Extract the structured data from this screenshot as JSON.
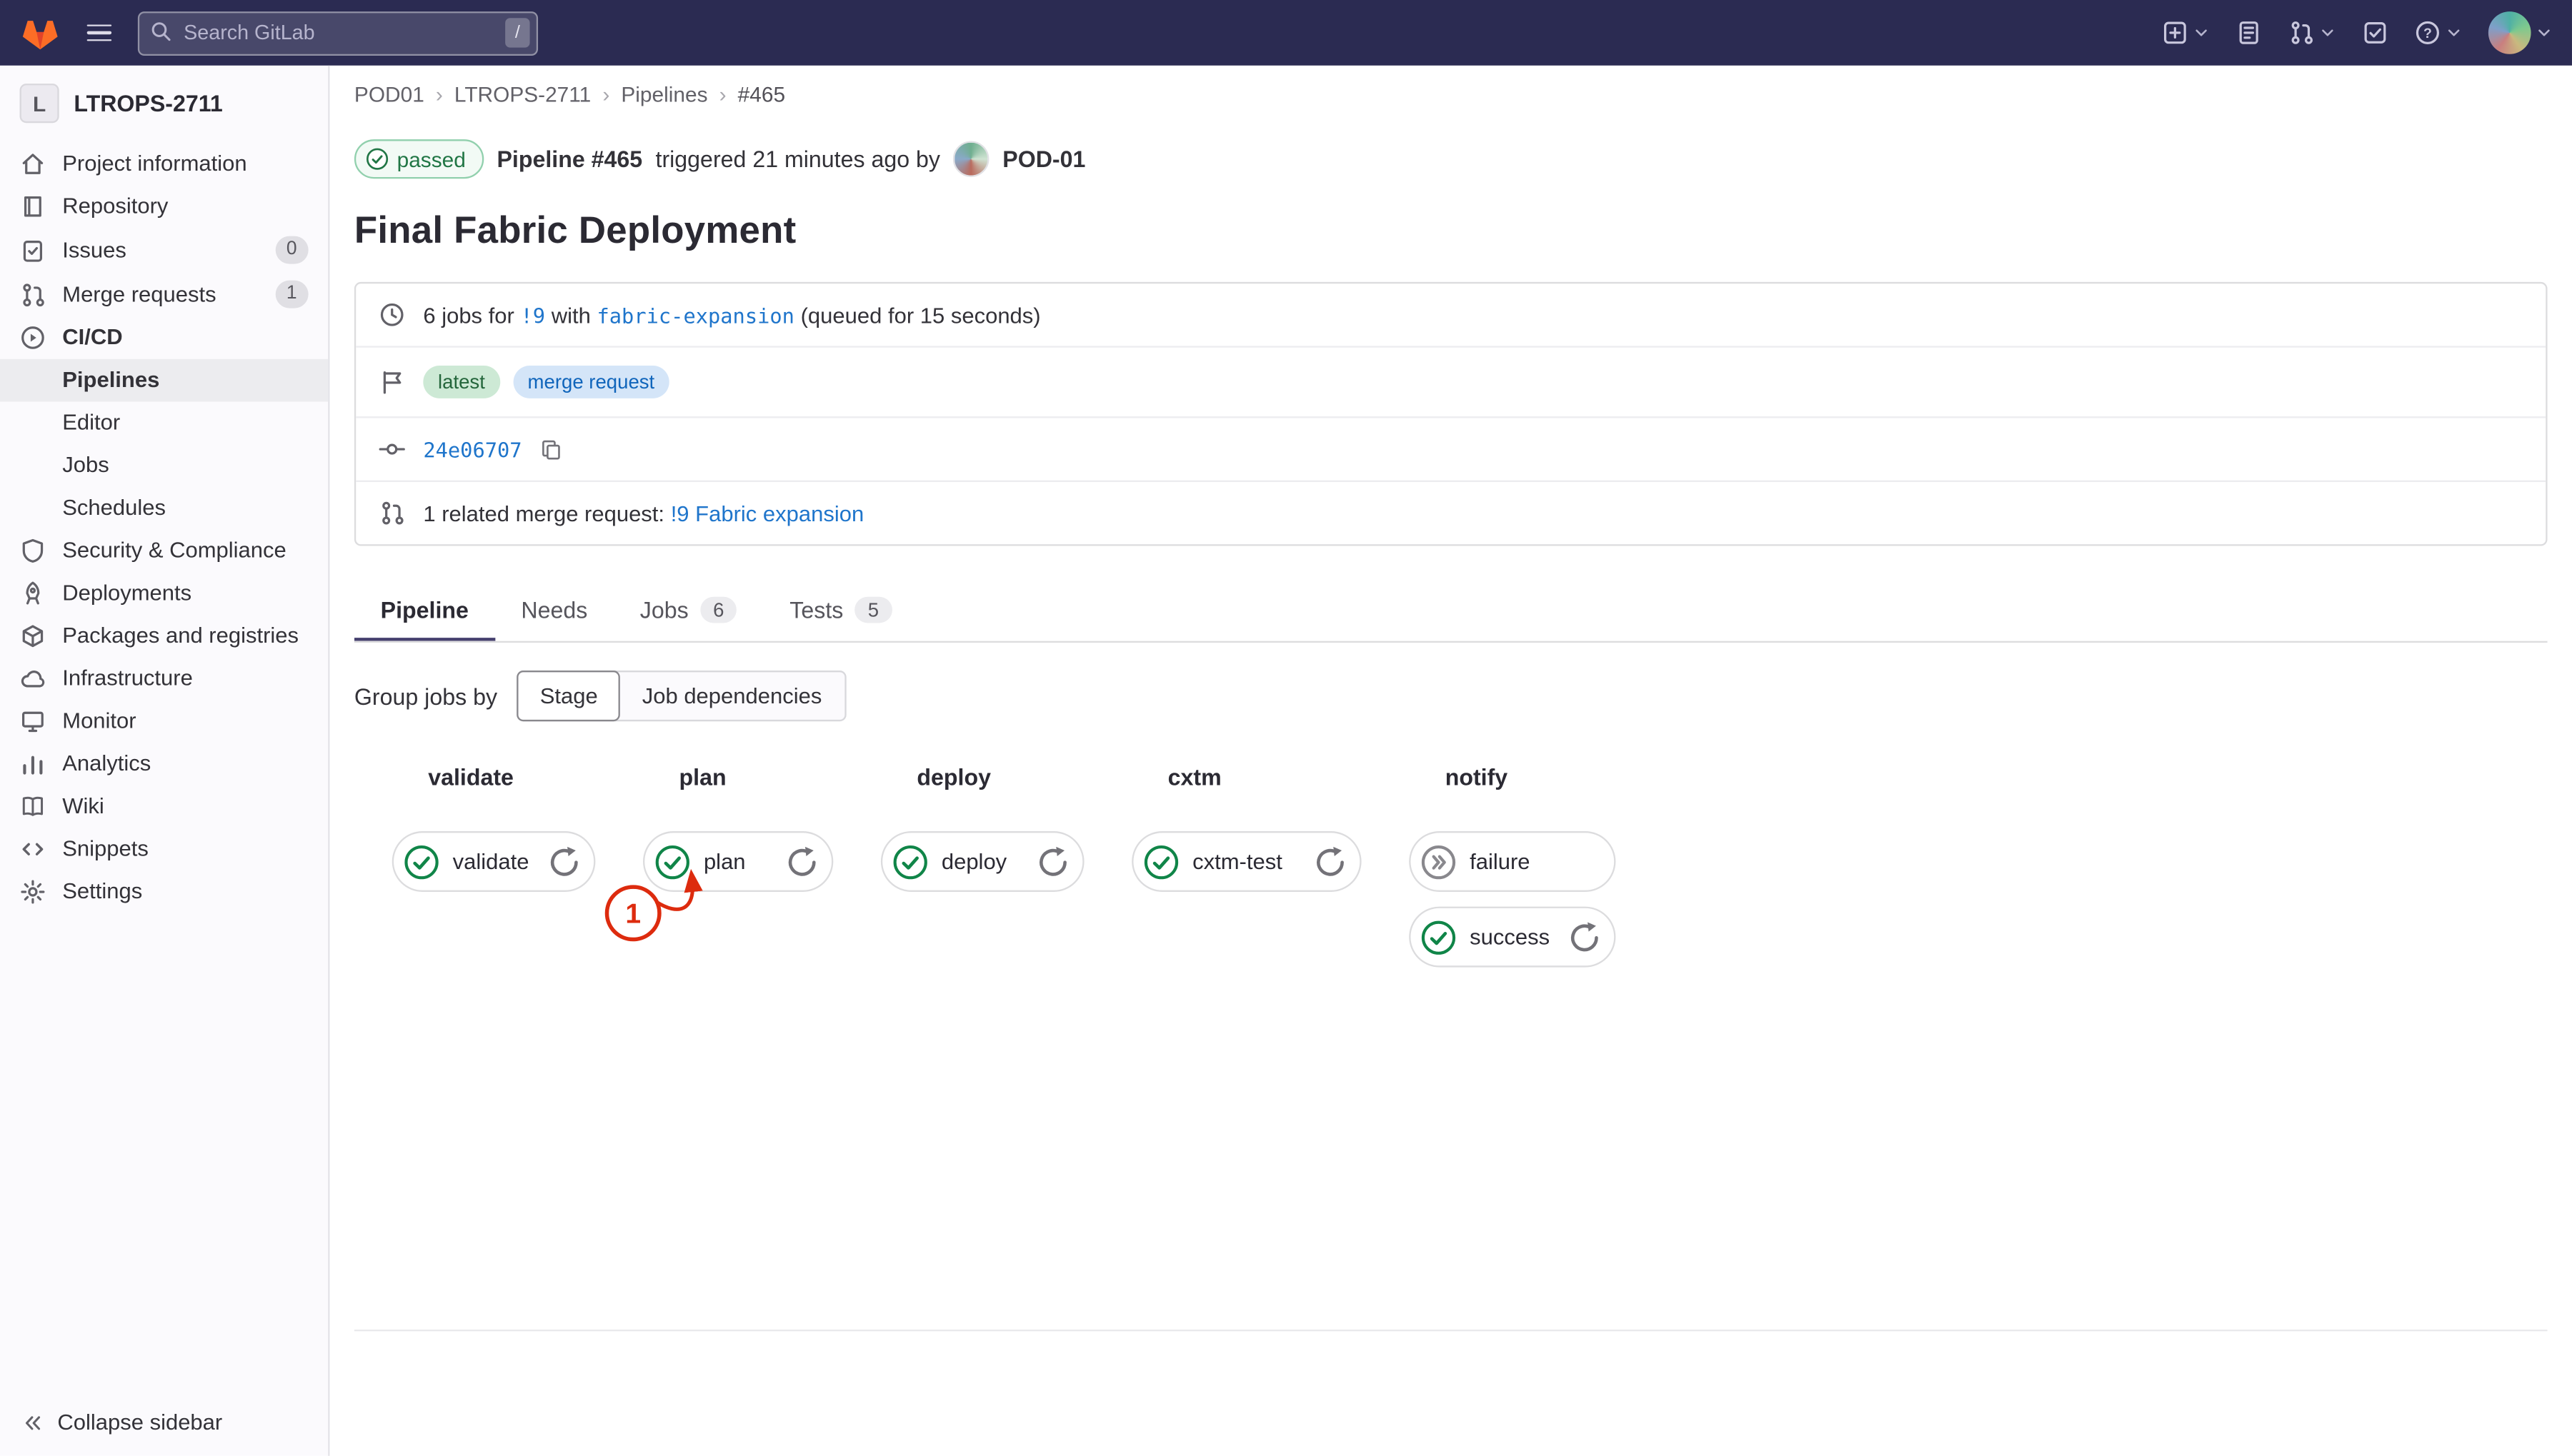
{
  "topbar": {
    "search_placeholder": "Search GitLab",
    "search_shortcut": "/",
    "right_icons": [
      {
        "id": "new-menu",
        "chevron": true
      },
      {
        "id": "issues",
        "chevron": false
      },
      {
        "id": "merge-requests",
        "chevron": true
      },
      {
        "id": "todo",
        "chevron": false
      },
      {
        "id": "help",
        "chevron": true
      },
      {
        "id": "user-avatar",
        "chevron": true
      }
    ]
  },
  "sidebar": {
    "project_initial": "L",
    "project_name": "LTROPS-2711",
    "items": [
      {
        "id": "project-information",
        "label": "Project information"
      },
      {
        "id": "repository",
        "label": "Repository"
      },
      {
        "id": "issues",
        "label": "Issues",
        "badge": "0"
      },
      {
        "id": "merge-requests",
        "label": "Merge requests",
        "badge": "1"
      },
      {
        "id": "ci-cd",
        "label": "CI/CD",
        "active": true,
        "children": [
          "Pipelines",
          "Editor",
          "Jobs",
          "Schedules"
        ],
        "active_child": "Pipelines"
      },
      {
        "id": "security-compliance",
        "label": "Security & Compliance"
      },
      {
        "id": "deployments",
        "label": "Deployments"
      },
      {
        "id": "packages-registries",
        "label": "Packages and registries"
      },
      {
        "id": "infrastructure",
        "label": "Infrastructure"
      },
      {
        "id": "monitor",
        "label": "Monitor"
      },
      {
        "id": "analytics",
        "label": "Analytics"
      },
      {
        "id": "wiki",
        "label": "Wiki"
      },
      {
        "id": "snippets",
        "label": "Snippets"
      },
      {
        "id": "settings",
        "label": "Settings"
      }
    ],
    "collapse_label": "Collapse sidebar"
  },
  "breadcrumb": {
    "items": [
      "POD01",
      "LTROPS-2711",
      "Pipelines",
      "#465"
    ],
    "separator": "›"
  },
  "pipeline_header": {
    "status_label": "passed",
    "pipeline_ref": "Pipeline #465",
    "triggered_text": "triggered 21 minutes ago by",
    "user_name": "POD-01"
  },
  "page_title": "Final Fabric Deployment",
  "details": {
    "jobs_prefix": "6 jobs for",
    "mr_link": "!9",
    "jobs_middle": "with",
    "branch": "fabric-expansion",
    "queued_note": "(queued for 15 seconds)",
    "labels": [
      {
        "text": "latest",
        "variant": "green"
      },
      {
        "text": "merge request",
        "variant": "blue"
      }
    ],
    "commit_sha": "24e06707",
    "related_mr_prefix": "1 related merge request:",
    "related_mr_link": "!9 Fabric expansion"
  },
  "tabs": [
    {
      "label": "Pipeline",
      "active": true
    },
    {
      "label": "Needs"
    },
    {
      "label": "Jobs",
      "badge": "6"
    },
    {
      "label": "Tests",
      "badge": "5"
    }
  ],
  "group_jobs": {
    "label": "Group jobs by",
    "options": [
      {
        "label": "Stage",
        "selected": true
      },
      {
        "label": "Job dependencies",
        "selected": false
      }
    ]
  },
  "pipeline_graph": {
    "stages": [
      {
        "name": "validate",
        "jobs": [
          {
            "name": "validate",
            "status": "success",
            "can_retry": true
          }
        ]
      },
      {
        "name": "plan",
        "jobs": [
          {
            "name": "plan",
            "status": "success",
            "can_retry": true
          }
        ]
      },
      {
        "name": "deploy",
        "jobs": [
          {
            "name": "deploy",
            "status": "success",
            "can_retry": true
          }
        ]
      },
      {
        "name": "cxtm",
        "jobs": [
          {
            "name": "cxtm-test",
            "status": "success",
            "can_retry": true
          }
        ]
      },
      {
        "name": "notify",
        "jobs": [
          {
            "name": "failure",
            "status": "skipped",
            "can_retry": false
          },
          {
            "name": "success",
            "status": "success",
            "can_retry": true
          }
        ]
      }
    ]
  },
  "annotation": {
    "label": "1"
  },
  "colors": {
    "success": "#108548",
    "accent": "#1f75cb",
    "annotation": "#dd2b0e",
    "navbar": "#2b2b52"
  }
}
